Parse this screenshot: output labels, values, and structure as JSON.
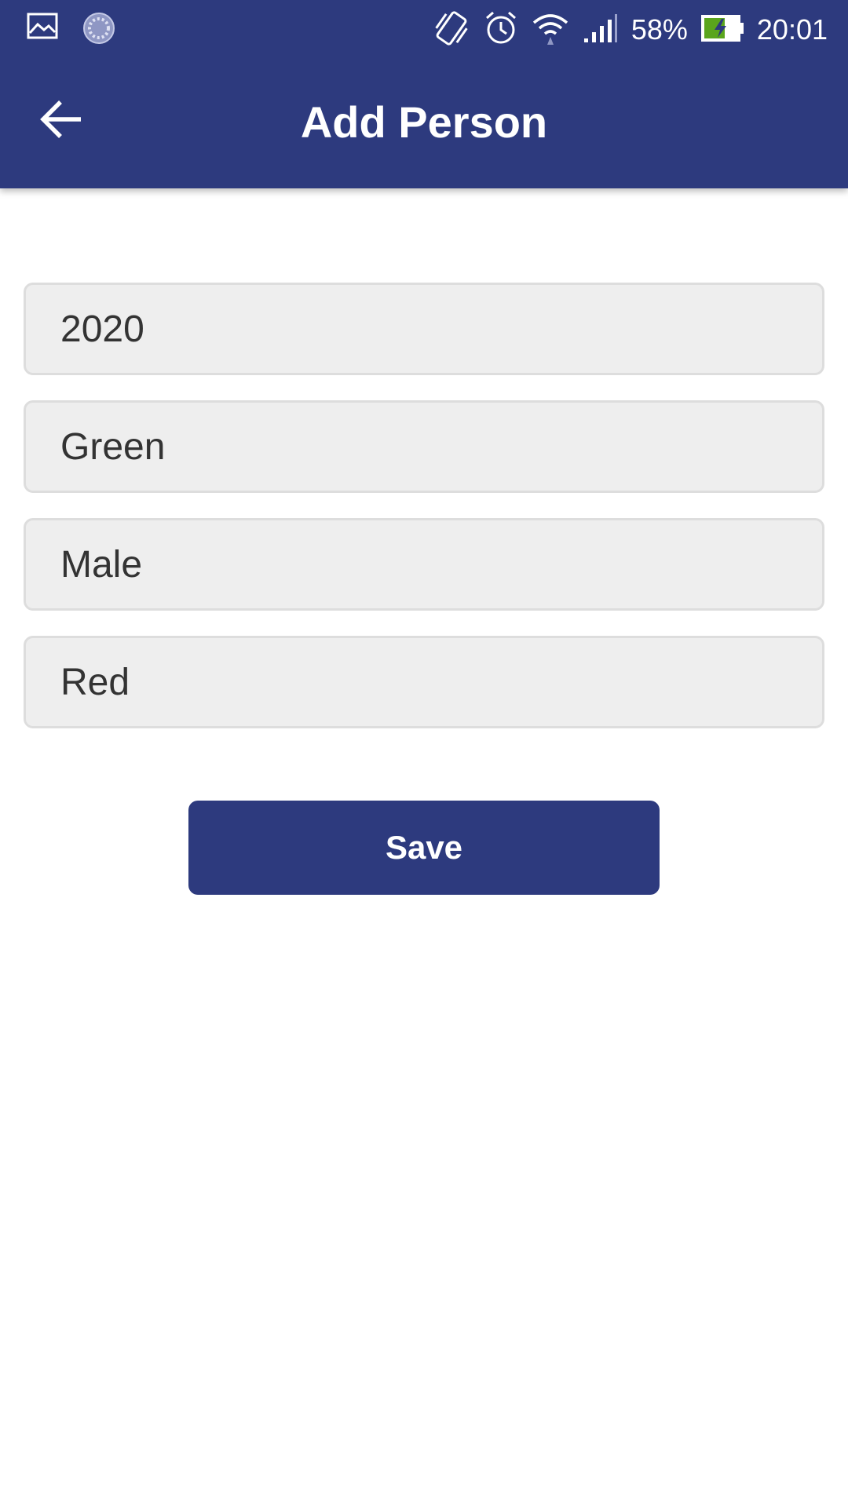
{
  "status_bar": {
    "battery_percent": "58%",
    "time": "20:01",
    "icons": [
      "image-icon",
      "sync-icon",
      "vibrate-icon",
      "alarm-icon",
      "wifi-icon",
      "signal-icon",
      "battery-charging-icon"
    ]
  },
  "header": {
    "title": "Add Person",
    "back_icon": "arrow-back-icon"
  },
  "form": {
    "fields": [
      {
        "value": "2020"
      },
      {
        "value": "Green"
      },
      {
        "value": "Male"
      },
      {
        "value": "Red"
      }
    ],
    "save_label": "Save"
  },
  "colors": {
    "primary": "#2d3a7e",
    "field_background": "#eeeeee",
    "field_border": "#dddddd",
    "text": "#333333"
  }
}
